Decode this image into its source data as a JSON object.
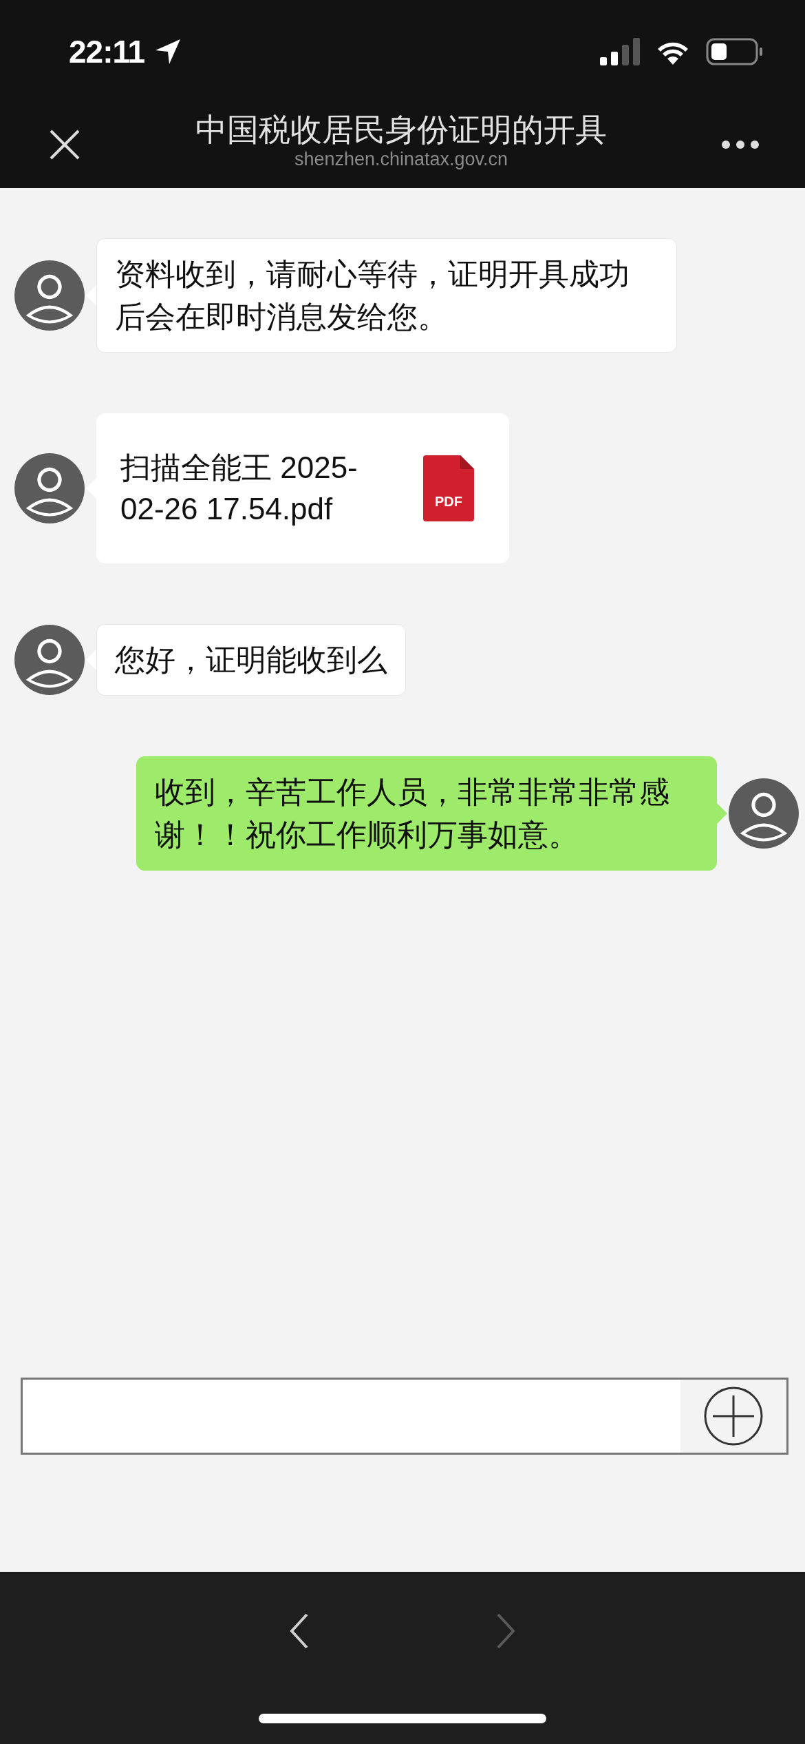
{
  "status_bar": {
    "time": "22:11"
  },
  "header": {
    "title": "中国税收居民身份证明的开具",
    "subtitle": "shenzhen.chinatax.gov.cn"
  },
  "messages": [
    {
      "kind": "text",
      "outgoing": false,
      "text": "资料收到，请耐心等待，证明开具成功后会在即时消息发给您。"
    },
    {
      "kind": "file",
      "outgoing": false,
      "text": "扫描全能王 2025-02-26 17.54.pdf",
      "file_label": "PDF"
    },
    {
      "kind": "text",
      "outgoing": false,
      "text": "您好，证明能收到么"
    },
    {
      "kind": "text",
      "outgoing": true,
      "text": "收到，辛苦工作人员，非常非常非常感谢！！祝你工作顺利万事如意。"
    }
  ],
  "nav": [
    {
      "kind": "back",
      "disabled": false
    },
    {
      "kind": "forward",
      "disabled": true
    }
  ]
}
